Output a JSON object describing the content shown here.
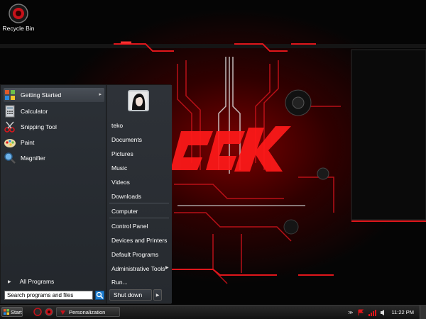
{
  "desktop": {
    "icons": [
      {
        "label": "Recycle Bin",
        "icon": "recycle-bin-icon"
      }
    ]
  },
  "start_menu": {
    "pinned_programs": [
      {
        "label": "Getting Started",
        "icon": "getting-started-icon",
        "has_submenu": true
      },
      {
        "label": "Calculator",
        "icon": "calculator-icon",
        "has_submenu": false
      },
      {
        "label": "Snipping Tool",
        "icon": "snipping-tool-icon",
        "has_submenu": false
      },
      {
        "label": "Paint",
        "icon": "paint-icon",
        "has_submenu": false
      },
      {
        "label": "Magnifier",
        "icon": "magnifier-icon",
        "has_submenu": false
      }
    ],
    "all_programs_label": "All Programs",
    "search_placeholder": "Search programs and files",
    "user_name": "teko",
    "right_items": [
      {
        "label": "Documents"
      },
      {
        "label": "Pictures"
      },
      {
        "label": "Music"
      },
      {
        "label": "Videos"
      },
      {
        "label": "Downloads"
      },
      {
        "label": "Computer"
      },
      {
        "label": "Control Panel"
      },
      {
        "label": "Devices and Printers"
      },
      {
        "label": "Default Programs"
      },
      {
        "label": "Administrative Tools",
        "has_submenu": true
      },
      {
        "label": "Run..."
      }
    ],
    "shutdown_label": "Shut down"
  },
  "taskbar": {
    "start_label": "Start",
    "window_buttons": [
      {
        "label": "Personalization",
        "icon": "personalization-icon"
      }
    ],
    "clock": "11:22 PM"
  },
  "colors": {
    "accent_red": "#e0161b",
    "menu_bg": "#2a2e33",
    "search_blue": "#1f7fd1"
  }
}
